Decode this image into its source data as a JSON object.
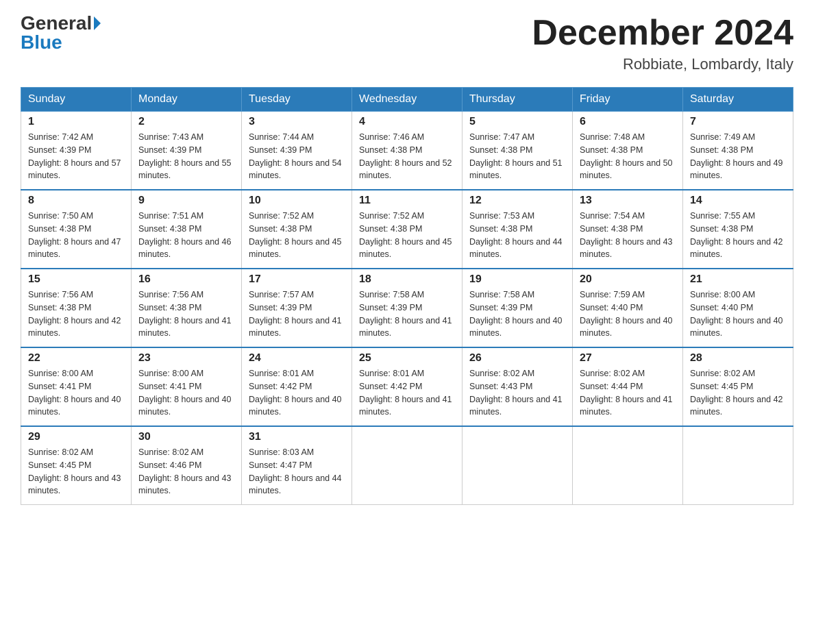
{
  "header": {
    "logo_general": "General",
    "logo_blue": "Blue",
    "month_title": "December 2024",
    "location": "Robbiate, Lombardy, Italy"
  },
  "days_of_week": [
    "Sunday",
    "Monday",
    "Tuesday",
    "Wednesday",
    "Thursday",
    "Friday",
    "Saturday"
  ],
  "weeks": [
    [
      {
        "day": "1",
        "sunrise": "7:42 AM",
        "sunset": "4:39 PM",
        "daylight": "8 hours and 57 minutes."
      },
      {
        "day": "2",
        "sunrise": "7:43 AM",
        "sunset": "4:39 PM",
        "daylight": "8 hours and 55 minutes."
      },
      {
        "day": "3",
        "sunrise": "7:44 AM",
        "sunset": "4:39 PM",
        "daylight": "8 hours and 54 minutes."
      },
      {
        "day": "4",
        "sunrise": "7:46 AM",
        "sunset": "4:38 PM",
        "daylight": "8 hours and 52 minutes."
      },
      {
        "day": "5",
        "sunrise": "7:47 AM",
        "sunset": "4:38 PM",
        "daylight": "8 hours and 51 minutes."
      },
      {
        "day": "6",
        "sunrise": "7:48 AM",
        "sunset": "4:38 PM",
        "daylight": "8 hours and 50 minutes."
      },
      {
        "day": "7",
        "sunrise": "7:49 AM",
        "sunset": "4:38 PM",
        "daylight": "8 hours and 49 minutes."
      }
    ],
    [
      {
        "day": "8",
        "sunrise": "7:50 AM",
        "sunset": "4:38 PM",
        "daylight": "8 hours and 47 minutes."
      },
      {
        "day": "9",
        "sunrise": "7:51 AM",
        "sunset": "4:38 PM",
        "daylight": "8 hours and 46 minutes."
      },
      {
        "day": "10",
        "sunrise": "7:52 AM",
        "sunset": "4:38 PM",
        "daylight": "8 hours and 45 minutes."
      },
      {
        "day": "11",
        "sunrise": "7:52 AM",
        "sunset": "4:38 PM",
        "daylight": "8 hours and 45 minutes."
      },
      {
        "day": "12",
        "sunrise": "7:53 AM",
        "sunset": "4:38 PM",
        "daylight": "8 hours and 44 minutes."
      },
      {
        "day": "13",
        "sunrise": "7:54 AM",
        "sunset": "4:38 PM",
        "daylight": "8 hours and 43 minutes."
      },
      {
        "day": "14",
        "sunrise": "7:55 AM",
        "sunset": "4:38 PM",
        "daylight": "8 hours and 42 minutes."
      }
    ],
    [
      {
        "day": "15",
        "sunrise": "7:56 AM",
        "sunset": "4:38 PM",
        "daylight": "8 hours and 42 minutes."
      },
      {
        "day": "16",
        "sunrise": "7:56 AM",
        "sunset": "4:38 PM",
        "daylight": "8 hours and 41 minutes."
      },
      {
        "day": "17",
        "sunrise": "7:57 AM",
        "sunset": "4:39 PM",
        "daylight": "8 hours and 41 minutes."
      },
      {
        "day": "18",
        "sunrise": "7:58 AM",
        "sunset": "4:39 PM",
        "daylight": "8 hours and 41 minutes."
      },
      {
        "day": "19",
        "sunrise": "7:58 AM",
        "sunset": "4:39 PM",
        "daylight": "8 hours and 40 minutes."
      },
      {
        "day": "20",
        "sunrise": "7:59 AM",
        "sunset": "4:40 PM",
        "daylight": "8 hours and 40 minutes."
      },
      {
        "day": "21",
        "sunrise": "8:00 AM",
        "sunset": "4:40 PM",
        "daylight": "8 hours and 40 minutes."
      }
    ],
    [
      {
        "day": "22",
        "sunrise": "8:00 AM",
        "sunset": "4:41 PM",
        "daylight": "8 hours and 40 minutes."
      },
      {
        "day": "23",
        "sunrise": "8:00 AM",
        "sunset": "4:41 PM",
        "daylight": "8 hours and 40 minutes."
      },
      {
        "day": "24",
        "sunrise": "8:01 AM",
        "sunset": "4:42 PM",
        "daylight": "8 hours and 40 minutes."
      },
      {
        "day": "25",
        "sunrise": "8:01 AM",
        "sunset": "4:42 PM",
        "daylight": "8 hours and 41 minutes."
      },
      {
        "day": "26",
        "sunrise": "8:02 AM",
        "sunset": "4:43 PM",
        "daylight": "8 hours and 41 minutes."
      },
      {
        "day": "27",
        "sunrise": "8:02 AM",
        "sunset": "4:44 PM",
        "daylight": "8 hours and 41 minutes."
      },
      {
        "day": "28",
        "sunrise": "8:02 AM",
        "sunset": "4:45 PM",
        "daylight": "8 hours and 42 minutes."
      }
    ],
    [
      {
        "day": "29",
        "sunrise": "8:02 AM",
        "sunset": "4:45 PM",
        "daylight": "8 hours and 43 minutes."
      },
      {
        "day": "30",
        "sunrise": "8:02 AM",
        "sunset": "4:46 PM",
        "daylight": "8 hours and 43 minutes."
      },
      {
        "day": "31",
        "sunrise": "8:03 AM",
        "sunset": "4:47 PM",
        "daylight": "8 hours and 44 minutes."
      },
      null,
      null,
      null,
      null
    ]
  ]
}
